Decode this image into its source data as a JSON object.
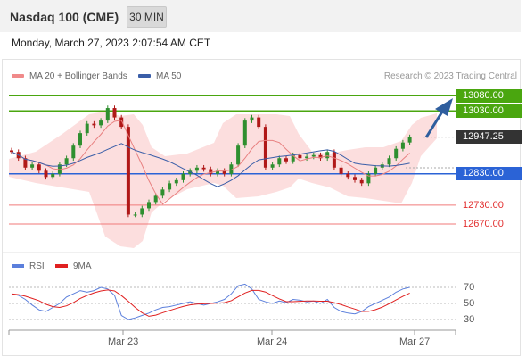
{
  "header": {
    "title": "Nasdaq 100 (CME)",
    "timeframe": "30 MIN"
  },
  "datetime": "Monday, March 27, 2023 2:07:54 AM CET",
  "legend": [
    {
      "label": "MA 20 + Bollinger Bands",
      "color": "#f08a8a"
    },
    {
      "label": "MA 50",
      "color": "#3a5ea8"
    }
  ],
  "copyright": "Research © 2023 Trading Central",
  "colors": {
    "up": "#2f8f2f",
    "down": "#b01818",
    "resistance": "#4aa60f",
    "pivot": "#2b63d6",
    "support": "#f07a7a",
    "last": "#333333",
    "arrow": "#2f5e9e",
    "band": "#fbd8d8",
    "ma20": "#e88080",
    "ma50": "#3a5ea8",
    "rsi": "#5b7fdc",
    "rsi_ma": "#e02020"
  },
  "levels": {
    "resistance": [
      "13080.00",
      "13030.00"
    ],
    "last": "12947.25",
    "pivot": "12830.00",
    "support": [
      "12730.00",
      "12670.00"
    ]
  },
  "rsi_panel": {
    "legend": [
      {
        "label": "RSI",
        "color": "#5b7fdc"
      },
      {
        "label": "9MA",
        "color": "#e02020"
      }
    ],
    "ticks": [
      "70",
      "50",
      "30"
    ]
  },
  "x_labels": [
    "Mar 23",
    "Mar 24",
    "Mar 27"
  ],
  "chart_data": {
    "type": "candlestick",
    "series": [
      {
        "name": "Price",
        "close": [
          12900,
          12880,
          12850,
          12860,
          12840,
          12820,
          12830,
          12860,
          12880,
          12920,
          12960,
          12990,
          12985,
          13000,
          13040,
          13010,
          12980,
          12700,
          12700,
          12720,
          12740,
          12760,
          12780,
          12800,
          12810,
          12830,
          12840,
          12850,
          12845,
          12830,
          12840,
          12830,
          12860,
          12920,
          13000,
          13010,
          12980,
          12850,
          12860,
          12880,
          12870,
          12890,
          12880,
          12885,
          12890,
          12880,
          12900,
          12850,
          12830,
          12820,
          12810,
          12800,
          12830,
          12850,
          12860,
          12880,
          12910,
          12930,
          12947.25
        ]
      }
    ],
    "resistance": [
      13080.0,
      13030.0
    ],
    "pivot": 12830.0,
    "support": [
      12730.0,
      12670.0
    ],
    "last": 12947.25,
    "rsi_ticks": [
      70,
      50,
      30
    ],
    "x_labels": [
      "Mar 23",
      "Mar 24",
      "Mar 27"
    ]
  }
}
